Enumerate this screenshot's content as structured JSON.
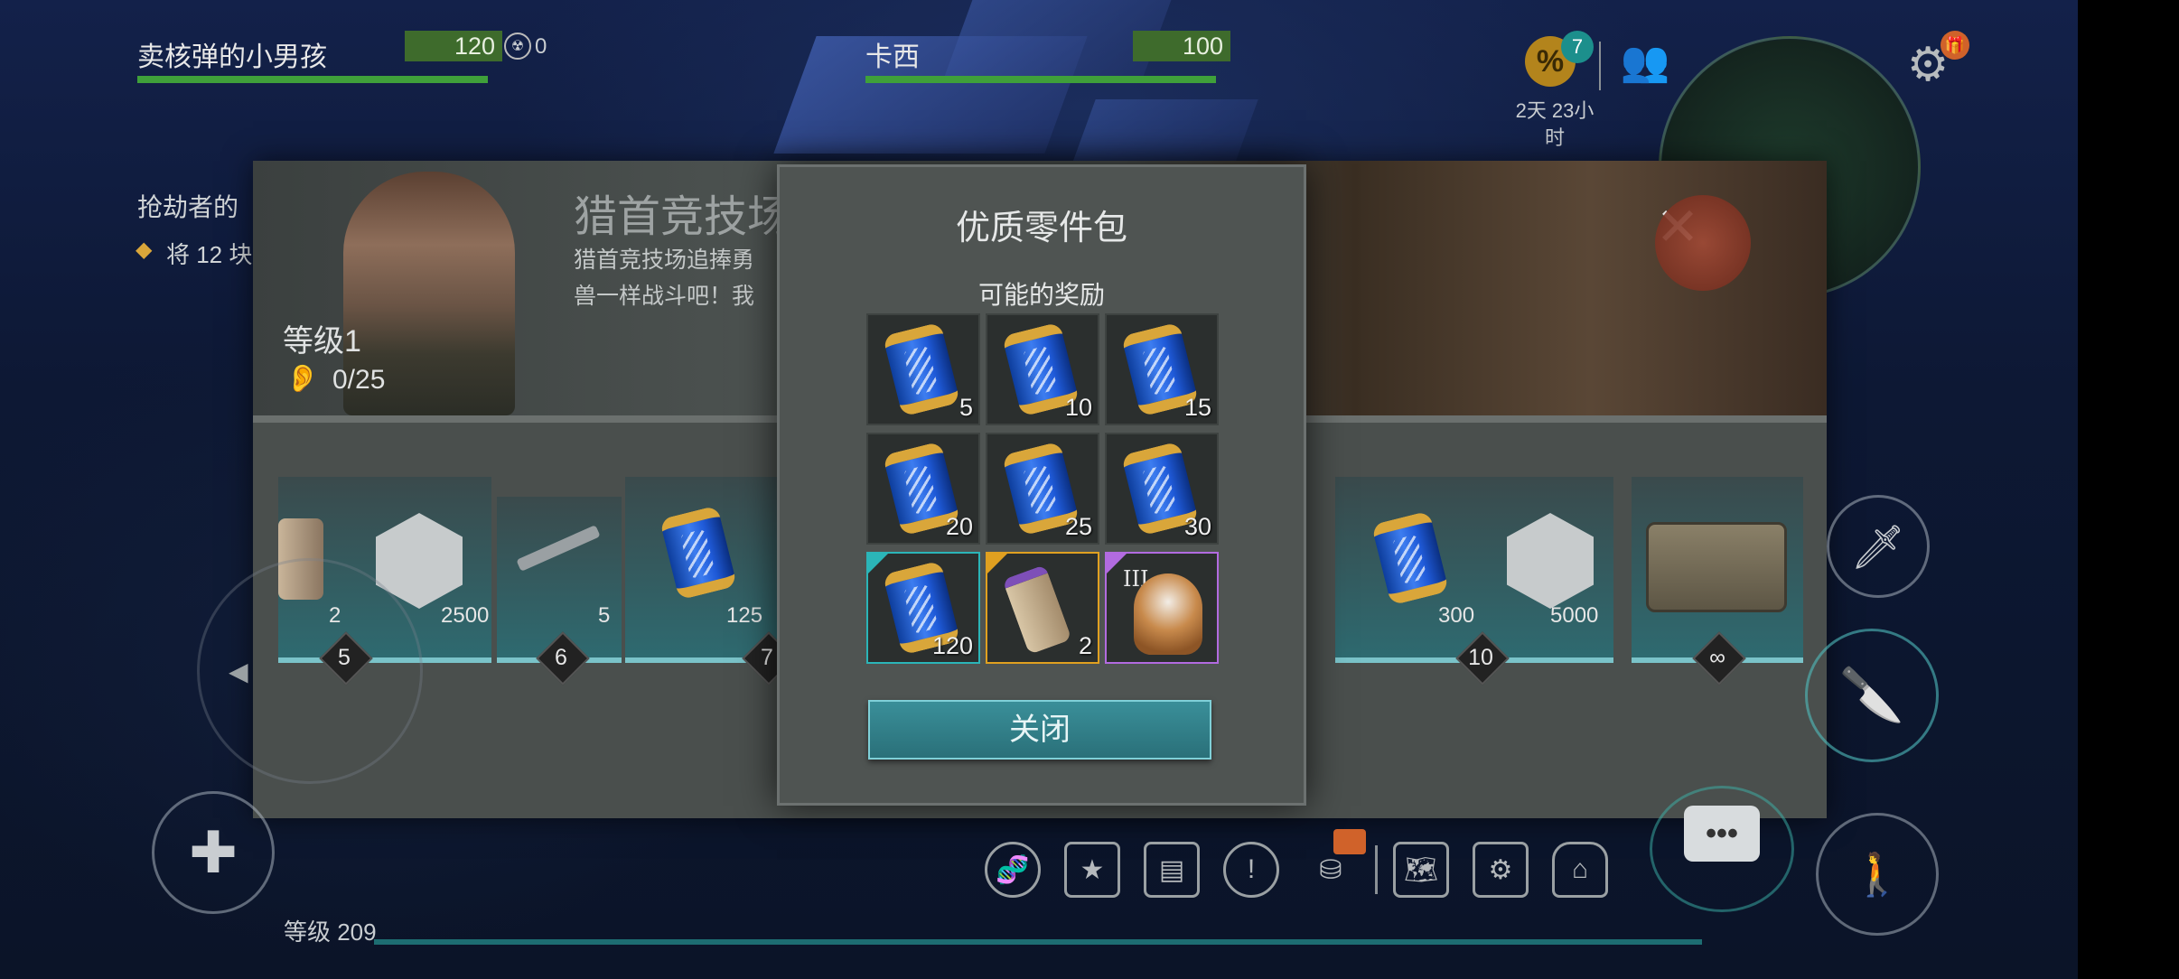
{
  "hud": {
    "player1": {
      "name": "卖核弹的小男孩",
      "hp": "120",
      "badge_count": "0"
    },
    "player2": {
      "name": "卡西",
      "hp": "100"
    },
    "promo_badge": "7",
    "timer": "2天 23小时",
    "level_label": "等级 209"
  },
  "left_quest": {
    "title": "抢劫者的",
    "line": "将 12 块"
  },
  "arena": {
    "title": "猎首竞技场",
    "desc_line1": "猎首竞技场追捧勇",
    "desc_line2": "兽一样战斗吧！我",
    "level": "等级1",
    "progress": "0/25",
    "tiers": [
      {
        "counts": [
          "2",
          "2500"
        ],
        "tier": "5"
      },
      {
        "counts": [
          "5"
        ],
        "tier": "6"
      },
      {
        "counts": [
          "125"
        ],
        "tier": "7"
      },
      {
        "counts": [
          "300",
          "5000"
        ],
        "tier": "10"
      },
      {
        "counts": [],
        "tier": "∞"
      }
    ]
  },
  "dialog": {
    "title": "优质零件包",
    "subtitle": "可能的奖励",
    "rewards": [
      {
        "icon": "dna-capsule-icon",
        "qty": "5"
      },
      {
        "icon": "dna-capsule-icon",
        "qty": "10"
      },
      {
        "icon": "dna-capsule-icon",
        "qty": "15"
      },
      {
        "icon": "dna-capsule-icon",
        "qty": "20"
      },
      {
        "icon": "dna-capsule-icon",
        "qty": "25"
      },
      {
        "icon": "dna-capsule-icon",
        "qty": "30"
      },
      {
        "icon": "dna-capsule-icon",
        "qty": "120",
        "rarity": "uncommon"
      },
      {
        "icon": "scroll-tube-icon",
        "qty": "2",
        "rarity": "rare"
      },
      {
        "icon": "dog-icon",
        "qty": "",
        "tier_label": "III",
        "rarity": "epic"
      }
    ],
    "close_label": "关闭"
  },
  "colors": {
    "accent_teal": "#2a7079",
    "uncommon": "#2bb5b8",
    "rare": "#e0a020",
    "epic": "#b26be0",
    "hp_green": "#3fa03a"
  }
}
